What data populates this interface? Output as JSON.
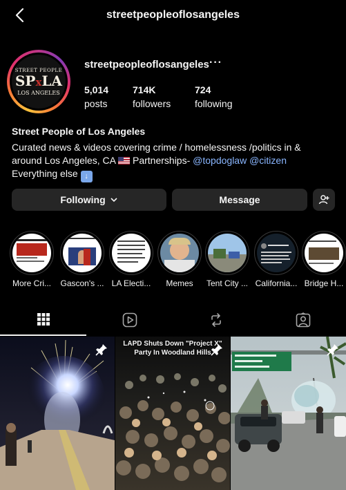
{
  "header": {
    "title": "streetpeopleoflosangeles",
    "back_icon": "chevron-left-icon"
  },
  "profile": {
    "username": "streetpeopleoflosangeles",
    "avatar_logo": {
      "top": "STREET PEOPLE",
      "mid_left": "SP",
      "mid_x": "x",
      "mid_right": "LA",
      "bottom": "LOS ANGELES"
    },
    "stats": {
      "posts": {
        "value": "5,014",
        "label": "posts"
      },
      "followers": {
        "value": "714K",
        "label": "followers"
      },
      "following": {
        "value": "724",
        "label": "following"
      }
    },
    "display_name": "Street People of Los Angeles",
    "bio": {
      "line1": "Curated news & videos covering crime / homelessness /politics in &",
      "line2_start": "around Los Angeles, CA ",
      "line2_after_flag": " Partnerships- ",
      "link1": "@topdoglaw",
      "link2": "@citizen",
      "line3": "Everything else "
    }
  },
  "actions": {
    "following": "Following",
    "message": "Message",
    "add_user_icon": "person-plus-icon"
  },
  "highlights": [
    {
      "label": "More Cri..."
    },
    {
      "label": "Gascon's ..."
    },
    {
      "label": "LA Electi..."
    },
    {
      "label": "Memes"
    },
    {
      "label": "Tent City ..."
    },
    {
      "label": "California..."
    },
    {
      "label": "Bridge H..."
    }
  ],
  "tabs": [
    {
      "name": "grid-icon",
      "active": true
    },
    {
      "name": "reels-icon",
      "active": false
    },
    {
      "name": "reposts-icon",
      "active": false
    },
    {
      "name": "tagged-icon",
      "active": false
    }
  ],
  "posts": [
    {
      "caption": "",
      "pinned": true
    },
    {
      "caption_line1": "LAPD Shuts Down \"Project X\"",
      "caption_line2": "Party In Woodland Hills",
      "pinned": true
    },
    {
      "caption": "",
      "pinned": true
    }
  ]
}
